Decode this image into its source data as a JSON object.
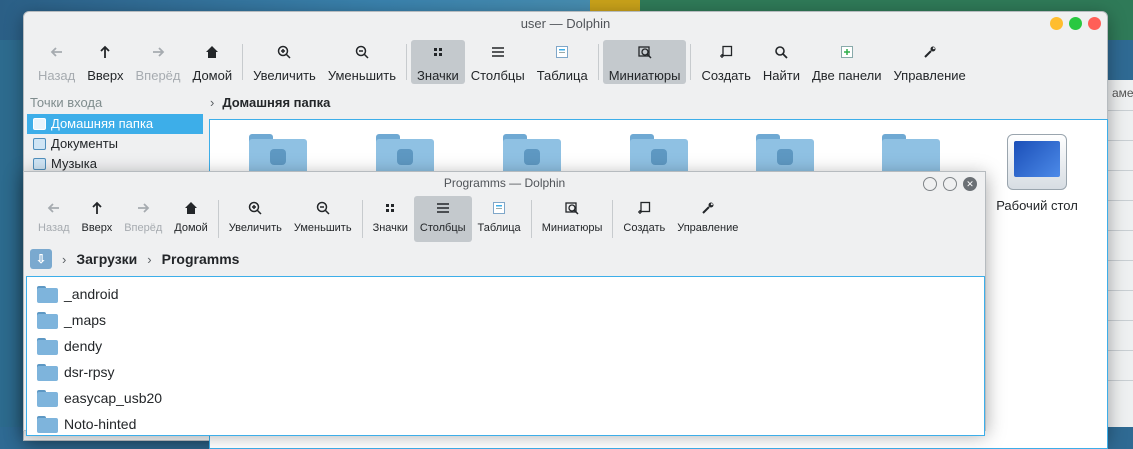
{
  "back_window": {
    "title": "user — Dolphin",
    "toolbar": [
      {
        "label": "Назад",
        "icon": "arrow-left-icon",
        "disabled": true
      },
      {
        "label": "Вверх",
        "icon": "arrow-up-icon"
      },
      {
        "label": "Вперёд",
        "icon": "arrow-right-icon",
        "disabled": true
      },
      {
        "label": "Домой",
        "icon": "home-icon"
      },
      {
        "label": "Увеличить",
        "icon": "zoom-in-icon"
      },
      {
        "label": "Уменьшить",
        "icon": "zoom-out-icon"
      },
      {
        "label": "Значки",
        "icon": "icons-view-icon",
        "pressed": true
      },
      {
        "label": "Столбцы",
        "icon": "columns-view-icon"
      },
      {
        "label": "Таблица",
        "icon": "table-view-icon"
      },
      {
        "label": "Миниатюры",
        "icon": "preview-icon",
        "pressed": true
      },
      {
        "label": "Создать",
        "icon": "new-icon"
      },
      {
        "label": "Найти",
        "icon": "search-icon"
      },
      {
        "label": "Две панели",
        "icon": "split-view-icon"
      },
      {
        "label": "Управление",
        "icon": "settings-icon"
      }
    ],
    "places_header": "Точки входа",
    "places": [
      "Домашняя папка",
      "Документы",
      "Музыка"
    ],
    "breadcrumb": "Домашняя папка",
    "desktop_item": "Рабочий стол"
  },
  "front_window": {
    "title": "Programms — Dolphin",
    "toolbar": [
      {
        "label": "Назад",
        "icon": "arrow-left-icon",
        "disabled": true
      },
      {
        "label": "Вверх",
        "icon": "arrow-up-icon"
      },
      {
        "label": "Вперёд",
        "icon": "arrow-right-icon",
        "disabled": true
      },
      {
        "label": "Домой",
        "icon": "home-icon"
      },
      {
        "label": "Увеличить",
        "icon": "zoom-in-icon"
      },
      {
        "label": "Уменьшить",
        "icon": "zoom-out-icon"
      },
      {
        "label": "Значки",
        "icon": "icons-view-icon"
      },
      {
        "label": "Столбцы",
        "icon": "columns-view-icon",
        "pressed": true
      },
      {
        "label": "Таблица",
        "icon": "table-view-icon"
      },
      {
        "label": "Миниатюры",
        "icon": "preview-icon"
      },
      {
        "label": "Создать",
        "icon": "new-icon"
      },
      {
        "label": "Управление",
        "icon": "settings-icon"
      }
    ],
    "breadcrumb": [
      "Загрузки",
      "Programms"
    ],
    "files": [
      "_android",
      "_maps",
      "dendy",
      "dsr-rpsy",
      "easycap_usb20",
      "Noto-hinted"
    ]
  },
  "edge_text": "аме",
  "colors": {
    "selection": "#3daee9",
    "folder": "#7eb4dc",
    "traffic_close": "#ffbd2e",
    "traffic_min": "#28c840",
    "traffic_max": "#ff5f57"
  }
}
